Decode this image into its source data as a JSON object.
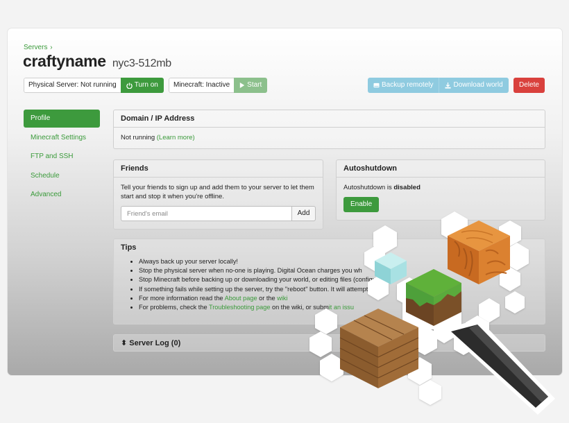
{
  "breadcrumb": {
    "label": "Servers",
    "chevron": "›"
  },
  "server": {
    "name": "craftyname",
    "size": "nyc3-512mb"
  },
  "controls": {
    "physical_label": "Physical Server: Not running",
    "turn_on": "Turn on",
    "minecraft_label": "Minecraft: Inactive",
    "start": "Start",
    "backup_remotely": "Backup remotely",
    "download_world": "Download world",
    "delete": "Delete"
  },
  "sidebar": {
    "items": [
      {
        "label": "Profile"
      },
      {
        "label": "Minecraft Settings"
      },
      {
        "label": "FTP and SSH"
      },
      {
        "label": "Schedule"
      },
      {
        "label": "Advanced"
      }
    ]
  },
  "domain": {
    "title": "Domain / IP Address",
    "status": "Not running",
    "learn_more": "(Learn more)"
  },
  "friends": {
    "title": "Friends",
    "description": "Tell your friends to sign up and add them to your server to let them start and stop it when you're offline.",
    "placeholder": "Friend's email",
    "add": "Add"
  },
  "autoshutdown": {
    "title": "Autoshutdown",
    "text": "Autoshutdown is ",
    "state": "disabled",
    "enable": "Enable"
  },
  "tips": {
    "title": "Tips",
    "items": [
      "Always back up your server locally!",
      "Stop the physical server when no-one is playing. Digital Ocean charges you wh",
      "Stop Minecraft before backing up or downloading your world, or editing files (configuratio",
      "If something fails while setting up the server, try the \"reboot\" button. It will attempt t",
      {
        "pre": "For more information read the ",
        "link1": "About page",
        "mid": " or the ",
        "link2": "wiki"
      },
      {
        "pre": "For problems, check the ",
        "link1": "Troubleshooting page",
        "mid": " on the wiki, or subm",
        "rest": "it an issu"
      }
    ]
  },
  "server_log": {
    "title": "Server Log (0)",
    "caret": "⬍"
  },
  "colors": {
    "accent": "#3d9a3d",
    "delete": "#d9413d",
    "info": "#8fcbe0"
  }
}
